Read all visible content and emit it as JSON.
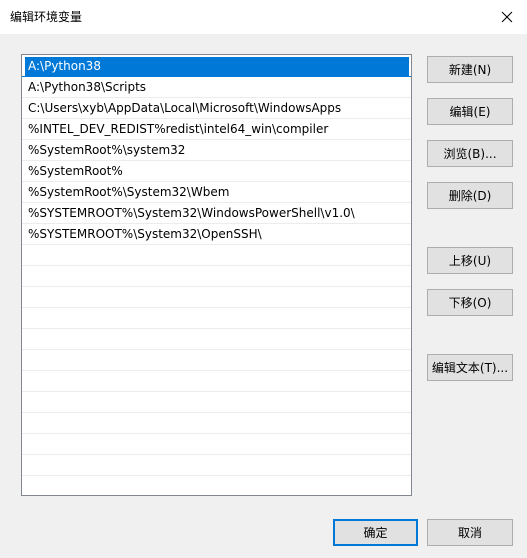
{
  "window": {
    "title": "编辑环境变量"
  },
  "path_list": {
    "items": [
      {
        "label": "A:\\Python38",
        "selected": true
      },
      {
        "label": "A:\\Python38\\Scripts",
        "selected": false
      },
      {
        "label": "C:\\Users\\xyb\\AppData\\Local\\Microsoft\\WindowsApps",
        "selected": false
      },
      {
        "label": "%INTEL_DEV_REDIST%redist\\intel64_win\\compiler",
        "selected": false
      },
      {
        "label": "%SystemRoot%\\system32",
        "selected": false
      },
      {
        "label": "%SystemRoot%",
        "selected": false
      },
      {
        "label": "%SystemRoot%\\System32\\Wbem",
        "selected": false
      },
      {
        "label": "%SYSTEMROOT%\\System32\\WindowsPowerShell\\v1.0\\",
        "selected": false
      },
      {
        "label": "%SYSTEMROOT%\\System32\\OpenSSH\\",
        "selected": false
      }
    ]
  },
  "buttons": {
    "new": "新建(N)",
    "edit": "编辑(E)",
    "browse": "浏览(B)...",
    "delete": "删除(D)",
    "move_up": "上移(U)",
    "move_down": "下移(O)",
    "edit_text": "编辑文本(T)...",
    "ok": "确定",
    "cancel": "取消"
  },
  "icons": {
    "close": "close-icon"
  },
  "colors": {
    "selection": "#0078d7",
    "window_bg": "#f0f0f0"
  }
}
